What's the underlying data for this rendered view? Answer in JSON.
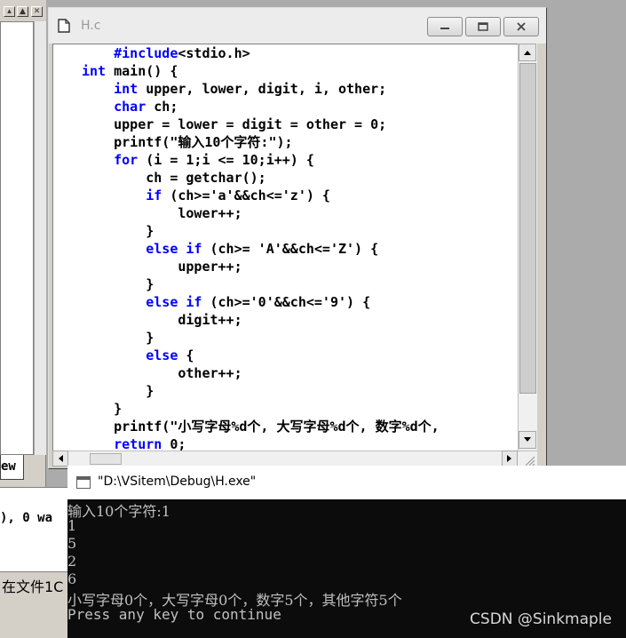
{
  "workspace": {
    "tab_label": "ew"
  },
  "output_pane": {
    "message": "), 0 wa",
    "status": "在文件1C"
  },
  "editor": {
    "title": "H.c",
    "code_lines": [
      [
        {
          "t": "    "
        },
        {
          "t": "#include",
          "k": 1
        },
        {
          "t": "<stdio.h>"
        }
      ],
      [
        {
          "t": "int",
          "k": 1
        },
        {
          "t": " main() {"
        }
      ],
      [
        {
          "t": "    "
        },
        {
          "t": "int",
          "k": 1
        },
        {
          "t": " upper, lower, digit, i, other;"
        }
      ],
      [
        {
          "t": "    "
        },
        {
          "t": "char",
          "k": 1
        },
        {
          "t": " ch;"
        }
      ],
      [
        {
          "t": "    upper = lower = digit = other = 0;"
        }
      ],
      [
        {
          "t": "    printf(\"输入10个字符:\");"
        }
      ],
      [
        {
          "t": "    "
        },
        {
          "t": "for",
          "k": 1
        },
        {
          "t": " (i = 1;i <= 10;i++) {"
        }
      ],
      [
        {
          "t": "        ch = getchar();"
        }
      ],
      [
        {
          "t": "        "
        },
        {
          "t": "if",
          "k": 1
        },
        {
          "t": " (ch>='a'&&ch<='z') {"
        }
      ],
      [
        {
          "t": "            lower++;"
        }
      ],
      [
        {
          "t": "        }"
        }
      ],
      [
        {
          "t": "        "
        },
        {
          "t": "else if",
          "k": 1
        },
        {
          "t": " (ch>= 'A'&&ch<='Z') {"
        }
      ],
      [
        {
          "t": "            upper++;"
        }
      ],
      [
        {
          "t": "        }"
        }
      ],
      [
        {
          "t": "        "
        },
        {
          "t": "else if",
          "k": 1
        },
        {
          "t": " (ch>='0'&&ch<='9') {"
        }
      ],
      [
        {
          "t": "            digit++;"
        }
      ],
      [
        {
          "t": "        }"
        }
      ],
      [
        {
          "t": "        "
        },
        {
          "t": "else",
          "k": 1
        },
        {
          "t": " {"
        }
      ],
      [
        {
          "t": "            other++;"
        }
      ],
      [
        {
          "t": "        }"
        }
      ],
      [
        {
          "t": "    }"
        }
      ],
      [
        {
          "t": "    printf(\"小写字母%d个, 大写字母%d个, 数字%d个,"
        }
      ],
      [
        {
          "t": "    "
        },
        {
          "t": "return",
          "k": 1
        },
        {
          "t": " 0;"
        }
      ]
    ]
  },
  "console": {
    "title": "\"D:\\VSitem\\Debug\\H.exe\"",
    "lines": [
      "输入10个字符:1",
      "1",
      "5",
      "2",
      "6",
      "小写字母0个，大写字母0个，数字5个，其他字符5个",
      "Press any key to continue"
    ],
    "watermark": "CSDN @Sinkmaple"
  },
  "colors": {
    "keyword": "#0000ff",
    "console_bg": "#0c0c0c",
    "console_text": "#c0c0c0"
  }
}
